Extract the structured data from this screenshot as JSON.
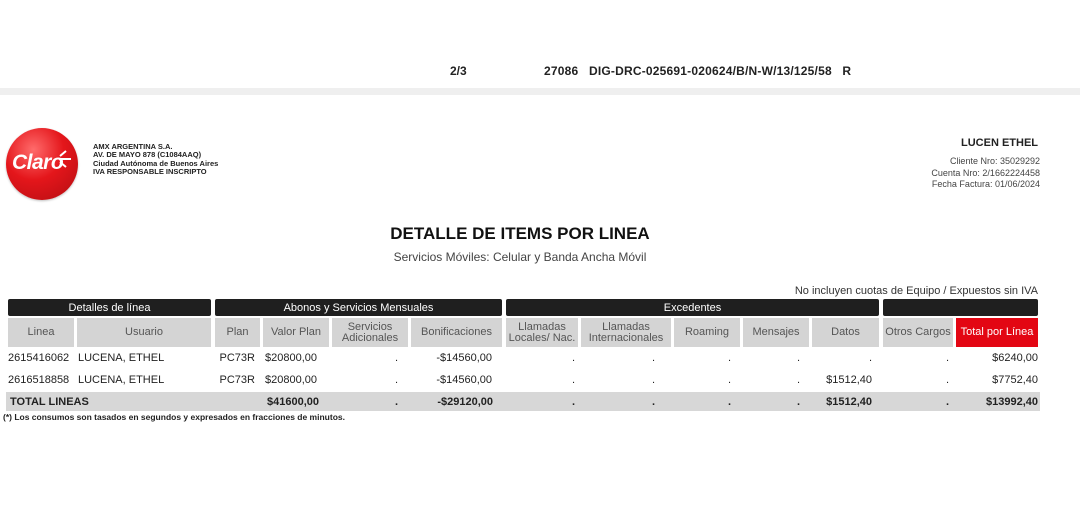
{
  "header": {
    "page": "2/3",
    "code": "27086   DIG-DRC-025691-020624/B/N-W/13/125/58   R"
  },
  "company": {
    "logo_text": "Claro",
    "lines": [
      "AMX ARGENTINA S.A.",
      "AV. DE MAYO 878 (C1084AAQ)",
      "Ciudad Autónoma de Buenos Aires",
      "IVA RESPONSABLE INSCRIPTO"
    ]
  },
  "customer": {
    "name": "LUCEN ETHEL",
    "cliente": "Cliente Nro: 35029292",
    "cuenta": "Cuenta Nro: 2/1662224458",
    "fecha": "Fecha Factura: 01/06/2024"
  },
  "title": "DETALLE DE ITEMS POR LINEA",
  "subtitle": "Servicios Móviles: Celular y Banda Ancha Móvil",
  "note": "No incluyen cuotas de Equipo / Expuestos sin IVA",
  "groups": [
    "Detalles de línea",
    "Abonos y Servicios Mensuales",
    "Excedentes"
  ],
  "columns": [
    "Linea",
    "Usuario",
    "Plan",
    "Valor Plan",
    "Servicios Adicionales",
    "Bonificaciones",
    "Llamadas Locales/ Nac.",
    "Llamadas Internacionales",
    "Roaming",
    "Mensajes",
    "Datos",
    "Otros Cargos",
    "Total por Línea"
  ],
  "rows": [
    [
      "2615416062",
      "LUCENA, ETHEL",
      "PC73R",
      "$20800,00",
      ".",
      "-$14560,00",
      ".",
      ".",
      ".",
      ".",
      ".",
      ".",
      "$6240,00"
    ],
    [
      "2616518858",
      "LUCENA, ETHEL",
      "PC73R",
      "$20800,00",
      ".",
      "-$14560,00",
      ".",
      ".",
      ".",
      ".",
      "$1512,40",
      ".",
      "$7752,40"
    ]
  ],
  "total": [
    "TOTAL LINEAS",
    "$41600,00",
    ".",
    "-$29120,00",
    ".",
    ".",
    ".",
    ".",
    "$1512,40",
    ".",
    "$13992,40"
  ],
  "footnote": "(*) Los consumos son tasados en segundos y expresados en fracciones de minutos."
}
